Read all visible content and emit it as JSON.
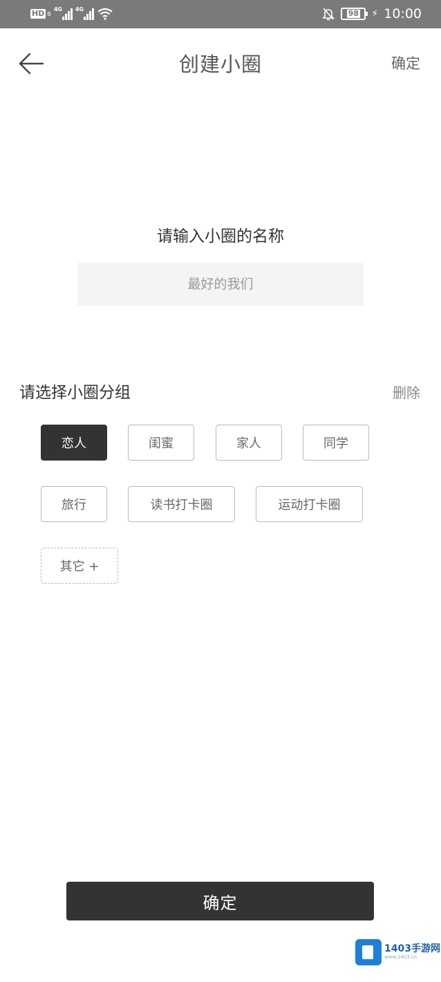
{
  "status_bar": {
    "hd_label": "HD",
    "hd_sub": "B",
    "signal_1_tag": "4G",
    "signal_2_tag": "4G",
    "battery": "98",
    "time": "10:00"
  },
  "nav": {
    "title": "创建小圈",
    "confirm_label": "确定"
  },
  "name_section": {
    "prompt": "请输入小圈的名称",
    "input_placeholder": "最好的我们",
    "input_value": ""
  },
  "group_section": {
    "title": "请选择小圈分组",
    "delete_label": "删除",
    "tags": [
      {
        "label": "恋人",
        "selected": true
      },
      {
        "label": "闺蜜",
        "selected": false
      },
      {
        "label": "家人",
        "selected": false
      },
      {
        "label": "同学",
        "selected": false
      },
      {
        "label": "旅行",
        "selected": false
      },
      {
        "label": "读书打卡圈",
        "selected": false
      },
      {
        "label": "运动打卡圈",
        "selected": false
      }
    ],
    "other_label": "其它 +"
  },
  "bottom": {
    "confirm_label": "确定"
  },
  "watermark": {
    "main": "1403手游网",
    "sub": "www.1403.cn"
  },
  "colors": {
    "status_bar_bg": "#7a7a7a",
    "primary_dark": "#333333",
    "input_bg": "#f2f4f6",
    "tag_border": "#b8b8b8"
  }
}
